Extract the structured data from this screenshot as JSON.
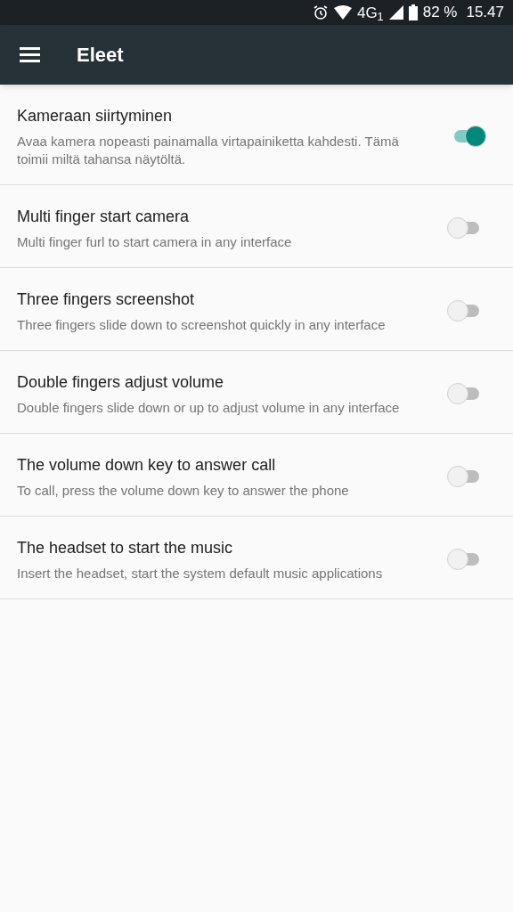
{
  "status_bar": {
    "network": "4G$_{1}$",
    "battery": "82 %",
    "time": "15.47"
  },
  "app_bar": {
    "title": "Eleet"
  },
  "settings": [
    {
      "title": "Kameraan siirtyminen",
      "summary": "Avaa kamera nopeasti painamalla virtapainiketta kahdesti. Tämä toimii miltä tahansa näytöltä.",
      "on": true
    },
    {
      "title": "Multi finger start camera",
      "summary": "Multi finger furl to start camera in any interface",
      "on": false
    },
    {
      "title": "Three fingers screenshot",
      "summary": "Three fingers slide down to screenshot quickly in any interface",
      "on": false
    },
    {
      "title": "Double fingers adjust volume",
      "summary": "Double fingers slide down or up to adjust volume in any interface",
      "on": false
    },
    {
      "title": "The volume down key to answer call",
      "summary": "To call, press the volume down key to answer the phone",
      "on": false
    },
    {
      "title": "The headset to start the music",
      "summary": "Insert the headset, start the system default music applications",
      "on": false
    }
  ]
}
